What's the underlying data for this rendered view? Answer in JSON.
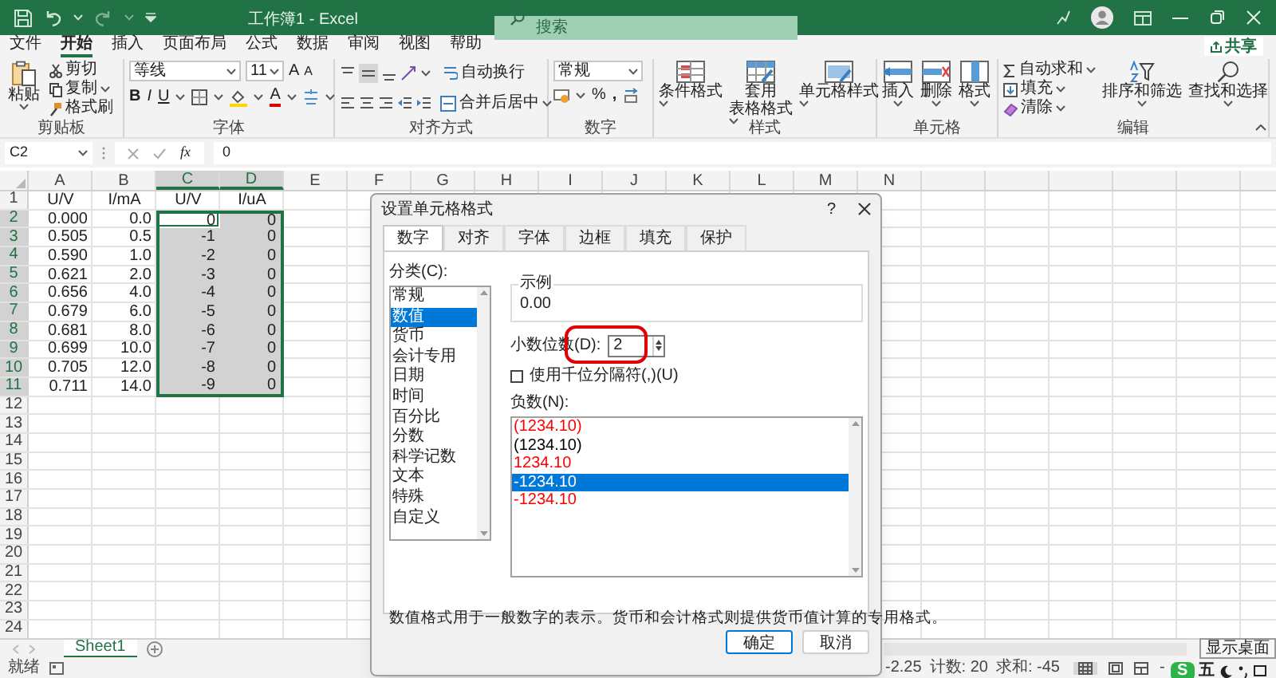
{
  "window": {
    "title": "工作簿1 - Excel",
    "search_placeholder": "搜索"
  },
  "menu_tabs": [
    {
      "label": "文件",
      "selected": false
    },
    {
      "label": "开始",
      "selected": true
    },
    {
      "label": "插入",
      "selected": false
    },
    {
      "label": "页面布局",
      "selected": false
    },
    {
      "label": "公式",
      "selected": false
    },
    {
      "label": "数据",
      "selected": false
    },
    {
      "label": "审阅",
      "selected": false
    },
    {
      "label": "视图",
      "selected": false
    },
    {
      "label": "帮助",
      "selected": false
    }
  ],
  "share_button": "共享",
  "clipboard": {
    "label": "剪贴板",
    "paste": "粘贴",
    "cut": "剪切",
    "copy": "复制",
    "format_painter": "格式刷"
  },
  "font": {
    "label": "字体",
    "name": "等线",
    "size": "11",
    "grow": "A",
    "shrink": "A",
    "bold": "B",
    "italic": "I",
    "underline": "U",
    "font_color": "A"
  },
  "alignment": {
    "label": "对齐方式",
    "wrap_text": "自动换行",
    "merge_center": "合并后居中"
  },
  "number": {
    "label": "数字",
    "format": "常规",
    "percent": "%",
    "comma": ","
  },
  "styles": {
    "label": "样式",
    "items": [
      {
        "lines": [
          "条件格式"
        ]
      },
      {
        "lines": [
          "套用",
          "表格格式"
        ]
      },
      {
        "lines": [
          "单元格样式"
        ]
      }
    ]
  },
  "cells_group": {
    "label": "单元格",
    "items": [
      "插入",
      "删除",
      "格式"
    ]
  },
  "editing": {
    "label": "编辑",
    "autosum": "自动求和",
    "fill": "填充",
    "clear": "清除",
    "sort_filter": "排序和筛选",
    "find_select": "查找和选择"
  },
  "formula_bar": {
    "name_box": "C2",
    "fx": "fx",
    "value": "0"
  },
  "sheet": {
    "columns": [
      {
        "label": "A",
        "selected": false
      },
      {
        "label": "B",
        "selected": false
      },
      {
        "label": "C",
        "selected": true
      },
      {
        "label": "D",
        "selected": true
      },
      {
        "label": "E",
        "selected": false
      },
      {
        "label": "F",
        "selected": false
      },
      {
        "label": "G",
        "selected": false
      },
      {
        "label": "H",
        "selected": false
      },
      {
        "label": "I",
        "selected": false
      },
      {
        "label": "J",
        "selected": false
      },
      {
        "label": "K",
        "selected": false
      },
      {
        "label": "L",
        "selected": false
      },
      {
        "label": "M",
        "selected": false
      },
      {
        "label": "N",
        "selected": false
      }
    ],
    "rows": [
      {
        "number": "1",
        "selected": false,
        "cells": [
          {
            "text": "U/V",
            "selected": false,
            "active": false
          },
          {
            "text": "I/mA",
            "selected": false,
            "active": false
          },
          {
            "text": "U/V",
            "selected": false,
            "active": false
          },
          {
            "text": "I/uA",
            "selected": false,
            "active": false
          }
        ]
      },
      {
        "number": "2",
        "selected": true,
        "cells": [
          {
            "text": "0.000",
            "selected": false,
            "active": false
          },
          {
            "text": "0.0",
            "selected": false,
            "active": false
          },
          {
            "text": "0",
            "selected": true,
            "active": true
          },
          {
            "text": "0",
            "selected": true,
            "active": false
          }
        ]
      },
      {
        "number": "3",
        "selected": true,
        "cells": [
          {
            "text": "0.505",
            "selected": false,
            "active": false
          },
          {
            "text": "0.5",
            "selected": false,
            "active": false
          },
          {
            "text": "-1",
            "selected": true,
            "active": false
          },
          {
            "text": "0",
            "selected": true,
            "active": false
          }
        ]
      },
      {
        "number": "4",
        "selected": true,
        "cells": [
          {
            "text": "0.590",
            "selected": false,
            "active": false
          },
          {
            "text": "1.0",
            "selected": false,
            "active": false
          },
          {
            "text": "-2",
            "selected": true,
            "active": false
          },
          {
            "text": "0",
            "selected": true,
            "active": false
          }
        ]
      },
      {
        "number": "5",
        "selected": true,
        "cells": [
          {
            "text": "0.621",
            "selected": false,
            "active": false
          },
          {
            "text": "2.0",
            "selected": false,
            "active": false
          },
          {
            "text": "-3",
            "selected": true,
            "active": false
          },
          {
            "text": "0",
            "selected": true,
            "active": false
          }
        ]
      },
      {
        "number": "6",
        "selected": true,
        "cells": [
          {
            "text": "0.656",
            "selected": false,
            "active": false
          },
          {
            "text": "4.0",
            "selected": false,
            "active": false
          },
          {
            "text": "-4",
            "selected": true,
            "active": false
          },
          {
            "text": "0",
            "selected": true,
            "active": false
          }
        ]
      },
      {
        "number": "7",
        "selected": true,
        "cells": [
          {
            "text": "0.679",
            "selected": false,
            "active": false
          },
          {
            "text": "6.0",
            "selected": false,
            "active": false
          },
          {
            "text": "-5",
            "selected": true,
            "active": false
          },
          {
            "text": "0",
            "selected": true,
            "active": false
          }
        ]
      },
      {
        "number": "8",
        "selected": true,
        "cells": [
          {
            "text": "0.681",
            "selected": false,
            "active": false
          },
          {
            "text": "8.0",
            "selected": false,
            "active": false
          },
          {
            "text": "-6",
            "selected": true,
            "active": false
          },
          {
            "text": "0",
            "selected": true,
            "active": false
          }
        ]
      },
      {
        "number": "9",
        "selected": true,
        "cells": [
          {
            "text": "0.699",
            "selected": false,
            "active": false
          },
          {
            "text": "10.0",
            "selected": false,
            "active": false
          },
          {
            "text": "-7",
            "selected": true,
            "active": false
          },
          {
            "text": "0",
            "selected": true,
            "active": false
          }
        ]
      },
      {
        "number": "10",
        "selected": true,
        "cells": [
          {
            "text": "0.705",
            "selected": false,
            "active": false
          },
          {
            "text": "12.0",
            "selected": false,
            "active": false
          },
          {
            "text": "-8",
            "selected": true,
            "active": false
          },
          {
            "text": "0",
            "selected": true,
            "active": false
          }
        ]
      },
      {
        "number": "11",
        "selected": true,
        "cells": [
          {
            "text": "0.711",
            "selected": false,
            "active": false
          },
          {
            "text": "14.0",
            "selected": false,
            "active": false
          },
          {
            "text": "-9",
            "selected": true,
            "active": false
          },
          {
            "text": "0",
            "selected": true,
            "active": false
          }
        ]
      },
      {
        "number": "12",
        "selected": false
      },
      {
        "number": "13",
        "selected": false
      },
      {
        "number": "14",
        "selected": false
      },
      {
        "number": "15",
        "selected": false
      },
      {
        "number": "16",
        "selected": false
      },
      {
        "number": "17",
        "selected": false
      },
      {
        "number": "18",
        "selected": false
      },
      {
        "number": "19",
        "selected": false
      },
      {
        "number": "20",
        "selected": false
      },
      {
        "number": "21",
        "selected": false
      },
      {
        "number": "22",
        "selected": false
      },
      {
        "number": "23",
        "selected": false
      },
      {
        "number": "24",
        "selected": false
      }
    ]
  },
  "dialog": {
    "title": "设置单元格格式",
    "help": "?",
    "tabs": [
      {
        "label": "数字",
        "selected": true
      },
      {
        "label": "对齐",
        "selected": false
      },
      {
        "label": "字体",
        "selected": false
      },
      {
        "label": "边框",
        "selected": false
      },
      {
        "label": "填充",
        "selected": false
      },
      {
        "label": "保护",
        "selected": false
      }
    ],
    "category_label": "分类(C):",
    "categories": [
      {
        "label": "常规",
        "selected": false
      },
      {
        "label": "数值",
        "selected": true
      },
      {
        "label": "货币",
        "selected": false
      },
      {
        "label": "会计专用",
        "selected": false
      },
      {
        "label": "日期",
        "selected": false
      },
      {
        "label": "时间",
        "selected": false
      },
      {
        "label": "百分比",
        "selected": false
      },
      {
        "label": "分数",
        "selected": false
      },
      {
        "label": "科学记数",
        "selected": false
      },
      {
        "label": "文本",
        "selected": false
      },
      {
        "label": "特殊",
        "selected": false
      },
      {
        "label": "自定义",
        "selected": false
      }
    ],
    "sample_label": "示例",
    "sample_value": "0.00",
    "decimal_label": "小数位数(D):",
    "decimal_value": "2",
    "thousands_separator": {
      "label": "使用千位分隔符(,)(U)",
      "checked": false
    },
    "negative_label": "负数(N):",
    "negative_formats": [
      {
        "text": "(1234.10)",
        "color": "#ff0000",
        "selected": false
      },
      {
        "text": "(1234.10)",
        "color": "#000000",
        "selected": false
      },
      {
        "text": "1234.10",
        "color": "#ff0000",
        "selected": false
      },
      {
        "text": "-1234.10",
        "selected": true
      },
      {
        "text": "-1234.10",
        "color": "#ff0000",
        "selected": false
      }
    ],
    "description": "数值格式用于一般数字的表示。货币和会计格式则提供货币值计算的专用格式。",
    "ok": "确定",
    "cancel": "取消"
  },
  "sheet_tabs": [
    {
      "label": "Sheet1",
      "selected": true
    }
  ],
  "status_bar": {
    "ready": "就绪",
    "average": "-2.25",
    "count": "计数: 20",
    "sum": "求和: -45",
    "zoom_out": "-"
  },
  "tray": {
    "ime_logo": "S",
    "ime_mode": "五",
    "tooltip": "显示桌面"
  }
}
